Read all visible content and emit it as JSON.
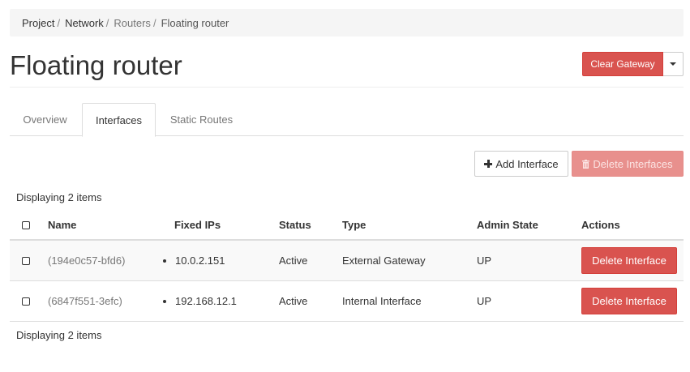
{
  "breadcrumb": {
    "items": [
      "Project",
      "Network",
      "Routers",
      "Floating router"
    ],
    "separator": "/"
  },
  "page": {
    "title": "Floating router"
  },
  "actions": {
    "clear_gateway_label": "Clear Gateway",
    "dropdown_icon": "caret-down-icon"
  },
  "tabs": [
    {
      "label": "Overview",
      "active": false
    },
    {
      "label": "Interfaces",
      "active": true
    },
    {
      "label": "Static Routes",
      "active": false
    }
  ],
  "table_actions": {
    "add_interface_label": "Add Interface",
    "add_interface_icon": "plus-icon",
    "delete_interfaces_label": "Delete Interfaces",
    "delete_interfaces_icon": "trash-icon",
    "delete_interfaces_disabled": true
  },
  "table": {
    "count_text_top": "Displaying 2 items",
    "count_text_bottom": "Displaying 2 items",
    "columns": [
      "Name",
      "Fixed IPs",
      "Status",
      "Type",
      "Admin State",
      "Actions"
    ],
    "rows": [
      {
        "name": "(194e0c57-bfd6)",
        "fixed_ip": "10.0.2.151",
        "status": "Active",
        "type": "External Gateway",
        "admin_state": "UP",
        "action_label": "Delete Interface"
      },
      {
        "name": "(6847f551-3efc)",
        "fixed_ip": "192.168.12.1",
        "status": "Active",
        "type": "Internal Interface",
        "admin_state": "UP",
        "action_label": "Delete Interface"
      }
    ]
  },
  "colors": {
    "danger": "#d9534f",
    "danger_disabled": "#e8908d",
    "breadcrumb_bg": "#f5f5f5",
    "link_muted": "#777777"
  }
}
